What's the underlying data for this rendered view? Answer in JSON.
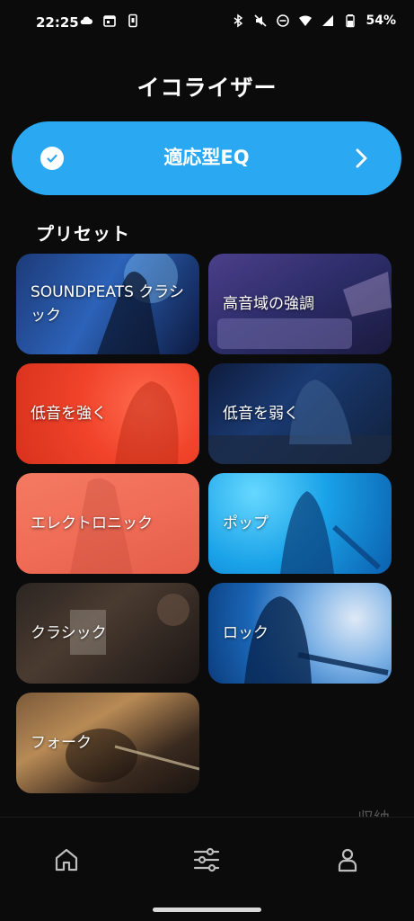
{
  "status_bar": {
    "time": "22:25",
    "battery_percent": "54%",
    "left_icons": [
      "cloud-icon",
      "calendar-icon",
      "phone-vibrate-icon"
    ],
    "right_icons": [
      "bluetooth-icon",
      "mute-icon",
      "dnd-icon",
      "wifi-icon",
      "signal-icon",
      "battery-icon"
    ]
  },
  "header": {
    "title": "イコライザー"
  },
  "adaptive_eq": {
    "label": "適応型EQ",
    "selected": true
  },
  "presets_section": {
    "title": "プリセット",
    "items": [
      {
        "label": "SOUNDPEATS クラシック"
      },
      {
        "label": "高音域の強調"
      },
      {
        "label": "低音を強く"
      },
      {
        "label": "低音を弱く"
      },
      {
        "label": "エレクトロニック"
      },
      {
        "label": "ポップ"
      },
      {
        "label": "クラシック"
      },
      {
        "label": "ロック"
      },
      {
        "label": "フォーク"
      }
    ]
  },
  "overflow_text": "収納",
  "bottom_nav": {
    "items": [
      {
        "icon": "home-icon"
      },
      {
        "icon": "equalizer-icon"
      },
      {
        "icon": "profile-icon"
      }
    ]
  },
  "colors": {
    "accent": "#2aa8f2",
    "background": "#0b0b0b"
  }
}
